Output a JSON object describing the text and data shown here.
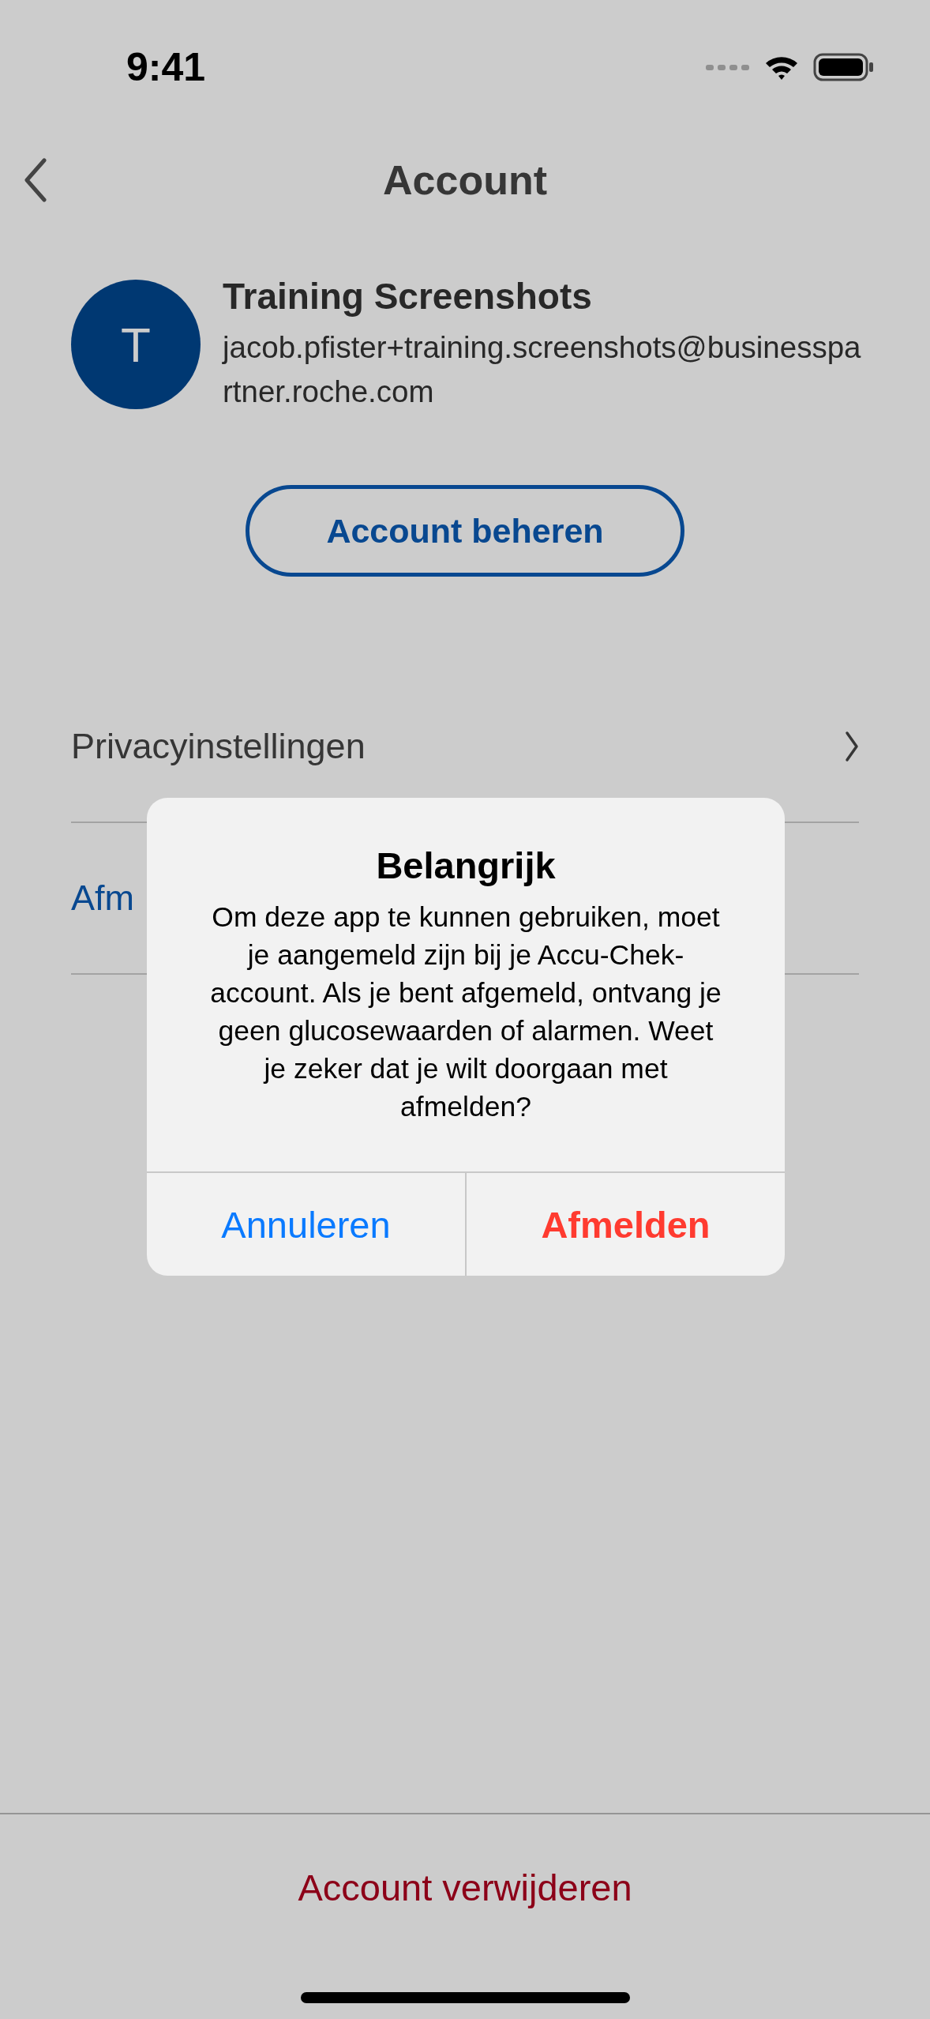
{
  "status_bar": {
    "time": "9:41"
  },
  "header": {
    "title": "Account"
  },
  "profile": {
    "initial": "T",
    "name": "Training Screenshots",
    "email": "jacob.pfister+training.screenshots@businesspartner.roche.com"
  },
  "manage_button": {
    "label": "Account beheren"
  },
  "menu": [
    {
      "label": "Privacyinstellingen",
      "kind": "link"
    },
    {
      "label": "Afm",
      "kind": "action"
    }
  ],
  "alert": {
    "title": "Belangrijk",
    "message": "Om deze app te kunnen gebruiken, moet je aangemeld zijn bij je Accu-Chek-account. Als je bent afgemeld, ontvang je geen glucosewaarden of alarmen. Weet je zeker dat je wilt doorgaan met afmelden?",
    "buttons": [
      {
        "label": "Annuleren",
        "kind": "cancel"
      },
      {
        "label": "Afmelden",
        "kind": "destructive"
      }
    ]
  },
  "footer": {
    "delete_button": "Account verwijderen"
  }
}
